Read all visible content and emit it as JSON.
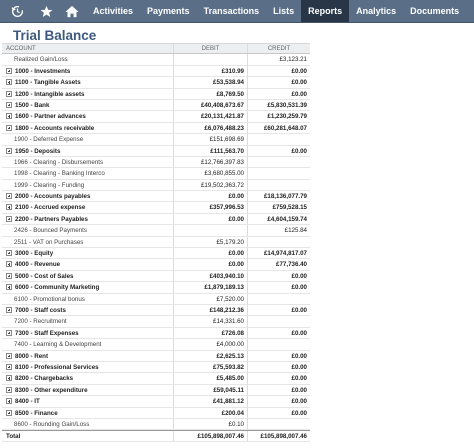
{
  "nav": {
    "icons": [
      "clock-icon",
      "star-icon",
      "home-icon"
    ],
    "items": [
      {
        "label": "Activities",
        "active": false
      },
      {
        "label": "Payments",
        "active": false
      },
      {
        "label": "Transactions",
        "active": false
      },
      {
        "label": "Lists",
        "active": false
      },
      {
        "label": "Reports",
        "active": true
      },
      {
        "label": "Analytics",
        "active": false
      },
      {
        "label": "Documents",
        "active": false
      }
    ]
  },
  "page": {
    "title": "Trial Balance"
  },
  "table": {
    "headers": {
      "account": "ACCOUNT",
      "debit": "DEBIT",
      "credit": "CREDIT"
    },
    "rows": [
      {
        "account": "Realized Gain/Loss",
        "debit": "",
        "credit": "£3,123.21",
        "level": "sub",
        "expandable": false
      },
      {
        "account": "1000 - Investments",
        "debit": "£310.99",
        "credit": "£0.00",
        "level": "top",
        "expandable": true
      },
      {
        "account": "1100 - Tangible Assets",
        "debit": "£53,538.94",
        "credit": "£0.00",
        "level": "top",
        "expandable": true
      },
      {
        "account": "1200 - Intangible assets",
        "debit": "£8,769.50",
        "credit": "£0.00",
        "level": "top",
        "expandable": true
      },
      {
        "account": "1500 - Bank",
        "debit": "£40,408,673.67",
        "credit": "£5,830,531.39",
        "level": "top",
        "expandable": true
      },
      {
        "account": "1600 - Partner advances",
        "debit": "£20,131,421.87",
        "credit": "£1,230,259.79",
        "level": "top",
        "expandable": true
      },
      {
        "account": "1800 - Accounts receivable",
        "debit": "£6,076,488.23",
        "credit": "£60,281,648.07",
        "level": "top",
        "expandable": true
      },
      {
        "account": "1900 - Deferred Expense",
        "debit": "£151,698.69",
        "credit": "",
        "level": "sub",
        "expandable": false
      },
      {
        "account": "1950 - Deposits",
        "debit": "£111,563.70",
        "credit": "£0.00",
        "level": "top",
        "expandable": true
      },
      {
        "account": "1966 - Clearing - Disbursements",
        "debit": "£12,766,397.83",
        "credit": "",
        "level": "sub",
        "expandable": false
      },
      {
        "account": "1998 - Clearing - Banking Interco",
        "debit": "£3,680,855.00",
        "credit": "",
        "level": "sub",
        "expandable": false
      },
      {
        "account": "1999 - Clearing - Funding",
        "debit": "£19,502,363.72",
        "credit": "",
        "level": "sub",
        "expandable": false
      },
      {
        "account": "2000 - Accounts payables",
        "debit": "£0.00",
        "credit": "£18,136,077.79",
        "level": "top",
        "expandable": true
      },
      {
        "account": "2100 - Accrued expense",
        "debit": "£357,996.53",
        "credit": "£759,528.15",
        "level": "top",
        "expandable": true
      },
      {
        "account": "2200 - Partners Payables",
        "debit": "£0.00",
        "credit": "£4,604,159.74",
        "level": "top",
        "expandable": true
      },
      {
        "account": "2426 - Bounced Payments",
        "debit": "",
        "credit": "£125.84",
        "level": "sub",
        "expandable": false
      },
      {
        "account": "2511 - VAT on Purchases",
        "debit": "£5,179.20",
        "credit": "",
        "level": "sub",
        "expandable": false
      },
      {
        "account": "3000 - Equity",
        "debit": "£0.00",
        "credit": "£14,974,817.07",
        "level": "top",
        "expandable": true
      },
      {
        "account": "4000 - Revenue",
        "debit": "£0.00",
        "credit": "£77,736.40",
        "level": "top",
        "expandable": true
      },
      {
        "account": "5000 - Cost of Sales",
        "debit": "£403,940.10",
        "credit": "£0.00",
        "level": "top",
        "expandable": true
      },
      {
        "account": "6000 - Community Marketing",
        "debit": "£1,879,189.13",
        "credit": "£0.00",
        "level": "top",
        "expandable": true
      },
      {
        "account": "6100 - Promotional bonus",
        "debit": "£7,520.00",
        "credit": "",
        "level": "sub",
        "expandable": false
      },
      {
        "account": "7000 - Staff costs",
        "debit": "£148,212.36",
        "credit": "£0.00",
        "level": "top",
        "expandable": true
      },
      {
        "account": "7200 - Recruitment",
        "debit": "£14,331.60",
        "credit": "",
        "level": "sub",
        "expandable": false
      },
      {
        "account": "7300 - Staff Expenses",
        "debit": "£726.08",
        "credit": "£0.00",
        "level": "top",
        "expandable": true
      },
      {
        "account": "7400 - Learning & Development",
        "debit": "£4,000.00",
        "credit": "",
        "level": "sub",
        "expandable": false
      },
      {
        "account": "8000 - Rent",
        "debit": "£2,625.13",
        "credit": "£0.00",
        "level": "top",
        "expandable": true
      },
      {
        "account": "8100 - Professional Services",
        "debit": "£75,593.82",
        "credit": "£0.00",
        "level": "top",
        "expandable": true
      },
      {
        "account": "8200 - Chargebacks",
        "debit": "£5,485.00",
        "credit": "£0.00",
        "level": "top",
        "expandable": true
      },
      {
        "account": "8300 - Other expenditure",
        "debit": "£59,045.11",
        "credit": "£0.00",
        "level": "top",
        "expandable": true
      },
      {
        "account": "8400 - IT",
        "debit": "£41,881.12",
        "credit": "£0.00",
        "level": "top",
        "expandable": true
      },
      {
        "account": "8500 - Finance",
        "debit": "£200.04",
        "credit": "£0.00",
        "level": "top",
        "expandable": true
      },
      {
        "account": "8600 - Rounding Gain/Loss",
        "debit": "£0.10",
        "credit": "",
        "level": "sub",
        "expandable": false
      }
    ],
    "total": {
      "account": "Total",
      "debit": "£105,898,007.46",
      "credit": "£105,898,007.46"
    }
  }
}
